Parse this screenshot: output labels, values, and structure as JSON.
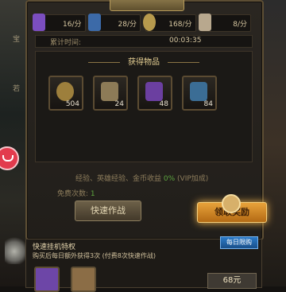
{
  "title": "",
  "stats": [
    {
      "name": "purple-gem-rate",
      "value": "16/分",
      "icon": "purple-gem-icon",
      "color": "#7b4ec0"
    },
    {
      "name": "blue-scroll-rate",
      "value": "28/分",
      "icon": "blue-scroll-icon",
      "color": "#3c6aa8"
    },
    {
      "name": "gold-rate",
      "value": "168/分",
      "icon": "coin-icon",
      "color": "#b79a4d"
    },
    {
      "name": "bone-rate",
      "value": "8/分",
      "icon": "bone-icon",
      "color": "#b8a88e"
    }
  ],
  "timer": {
    "label": "累计时间:",
    "value": "00:03:35"
  },
  "rewards_title": "获得物品",
  "items": [
    {
      "name": "coin-item",
      "qty": "504",
      "icon": "coin-icon",
      "color": "#9d7f3c"
    },
    {
      "name": "scroll-item",
      "qty": "24",
      "icon": "scroll-icon",
      "color": "#8d7b57"
    },
    {
      "name": "gem-item",
      "qty": "48",
      "icon": "purple-gem-icon",
      "color": "#6b3fa0"
    },
    {
      "name": "bottle-item",
      "qty": "84",
      "icon": "bottle-icon",
      "color": "#3b6d95"
    }
  ],
  "bonus": {
    "prefix": "经验、英雄经验、金币收益",
    "pct": "0%",
    "suffix": "(VIP加成)"
  },
  "free": {
    "label": "免费次数:",
    "value": "1"
  },
  "buttons": {
    "quick": "快速作战",
    "claim": "领取奖励"
  },
  "bottom": {
    "head": "快速挂机特权",
    "desc": "购买后每日额外获得3次 (付费8次快速作战)",
    "badge": "每日限购",
    "price": "68元"
  },
  "side": {
    "left_top": "宝",
    "left_mid": "若"
  }
}
